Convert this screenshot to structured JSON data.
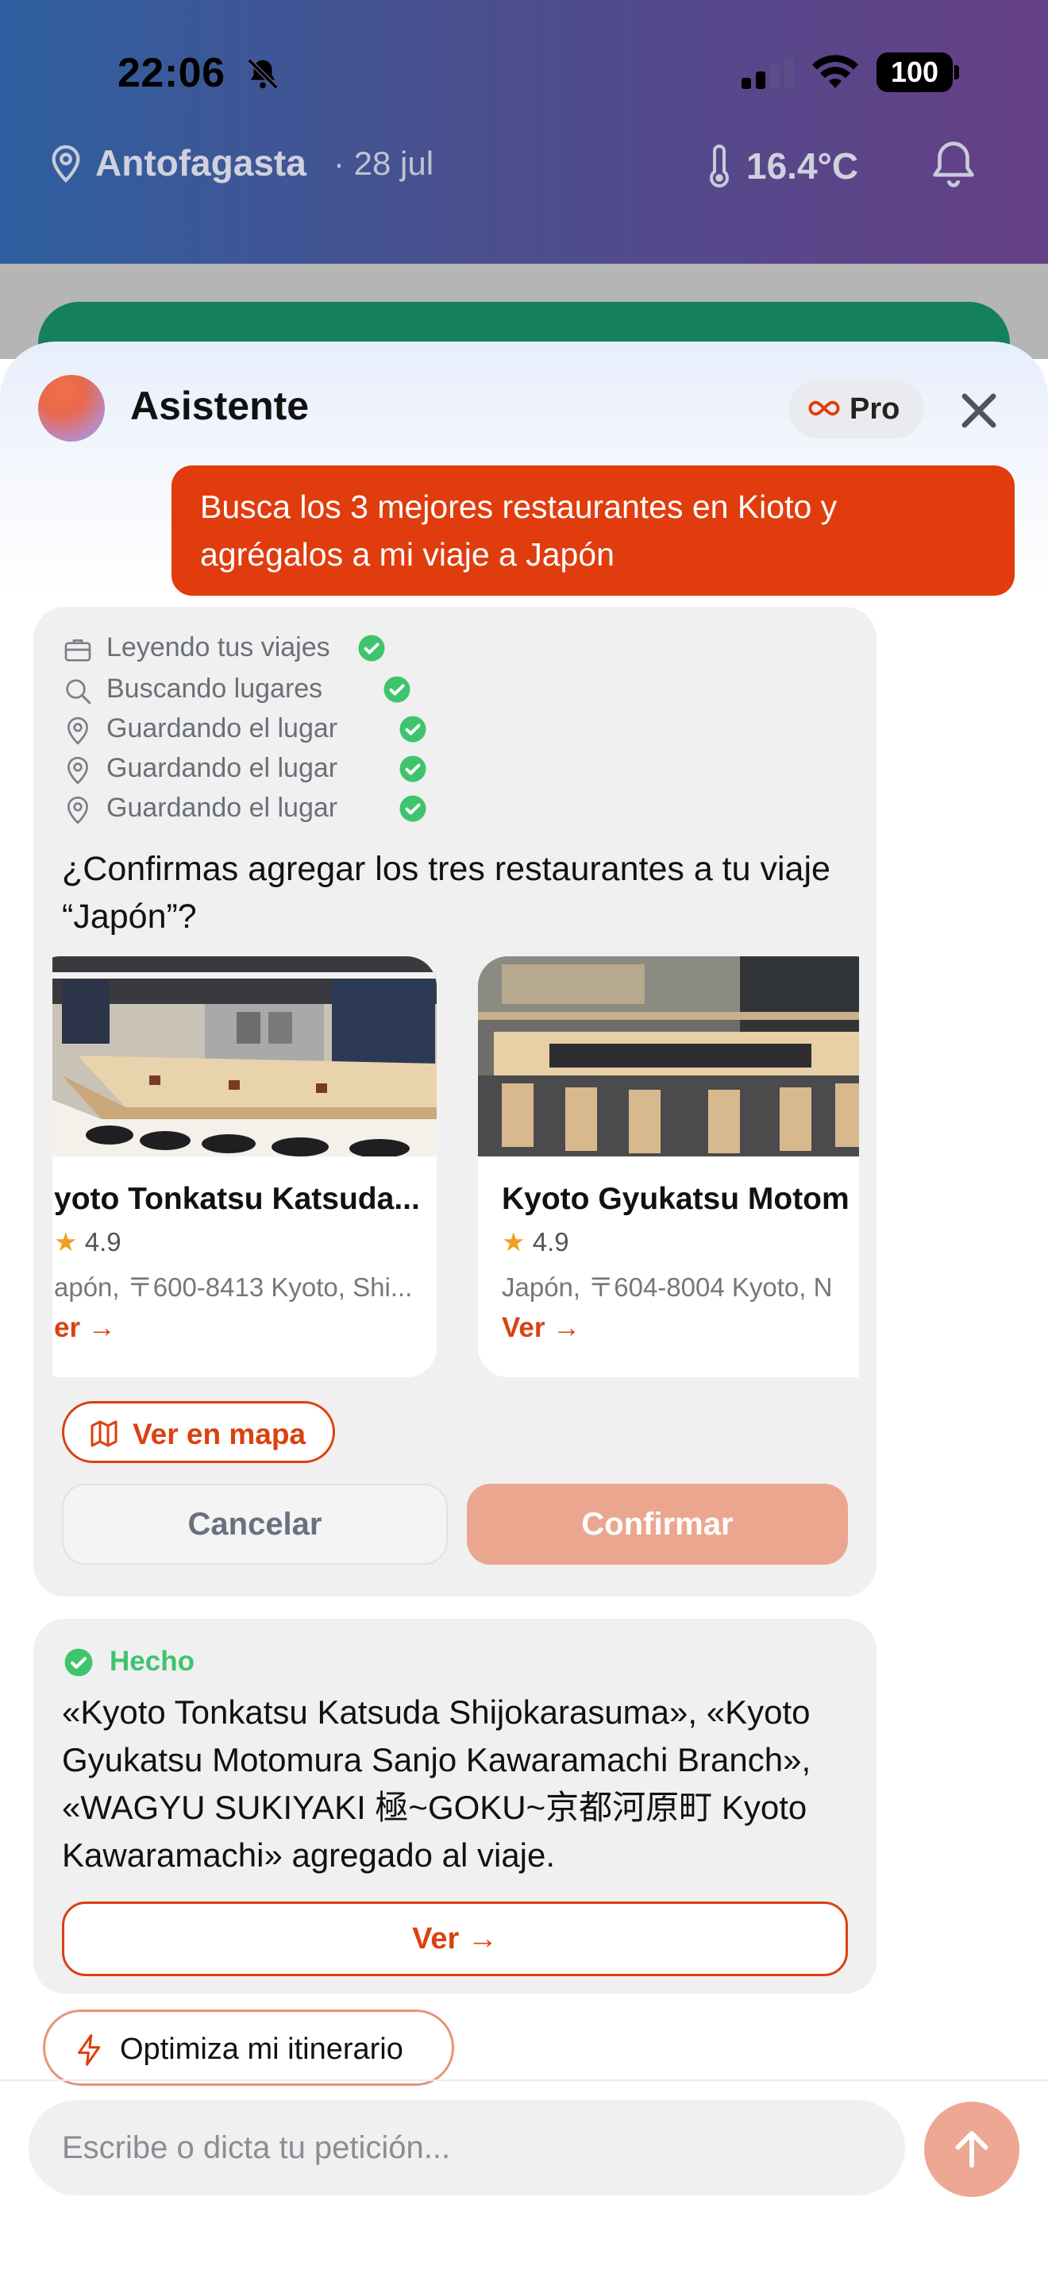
{
  "status_bar": {
    "time": "22:06",
    "battery": "100"
  },
  "header": {
    "city": "Antofagasta",
    "date": "· 28 jul",
    "temperature": "16.4°C"
  },
  "sheet": {
    "title": "Asistente",
    "plan_label": "Pro"
  },
  "user_message": "Busca los 3 mejores restaurantes en Kioto y agrégalos a mi viaje a Japón",
  "tool_steps": [
    {
      "icon": "briefcase-icon",
      "label": "Leyendo tus viajes"
    },
    {
      "icon": "search-icon",
      "label": "Buscando lugares"
    },
    {
      "icon": "pin-icon",
      "label": "Guardando el lugar"
    },
    {
      "icon": "pin-icon",
      "label": "Guardando el lugar"
    },
    {
      "icon": "pin-icon",
      "label": "Guardando el lugar"
    }
  ],
  "question": "¿Confirmas agregar los tres restaurantes a tu viaje “Japón”?",
  "restaurants": [
    {
      "name": "yoto Tonkatsu Katsuda...",
      "rating": "4.9",
      "address": "apón, 〒600-8413 Kyoto, Shi...",
      "link": "er"
    },
    {
      "name": "Kyoto Gyukatsu Motom",
      "rating": "4.9",
      "address": "Japón, 〒604-8004 Kyoto, N",
      "link": "Ver"
    }
  ],
  "map_button": "Ver en mapa",
  "cancel_button": "Cancelar",
  "confirm_button": "Confirmar",
  "done": {
    "label": "Hecho",
    "text": "«Kyoto Tonkatsu Katsuda Shijokarasuma», «Kyoto Gyukatsu Motomura Sanjo Kawaramachi Branch», «WAGYU SUKIYAKI 極~GOKU~京都河原町 Kyoto Kawaramachi» agregado al viaje.",
    "button": "Ver"
  },
  "suggestion": "Optimiza mi itinerario",
  "input": {
    "placeholder": "Escribe o dicta tu petición..."
  },
  "colors": {
    "accent": "#e03c0d",
    "success": "#3fc46e",
    "header_start": "#2f5fa0",
    "header_end": "#653f86"
  }
}
